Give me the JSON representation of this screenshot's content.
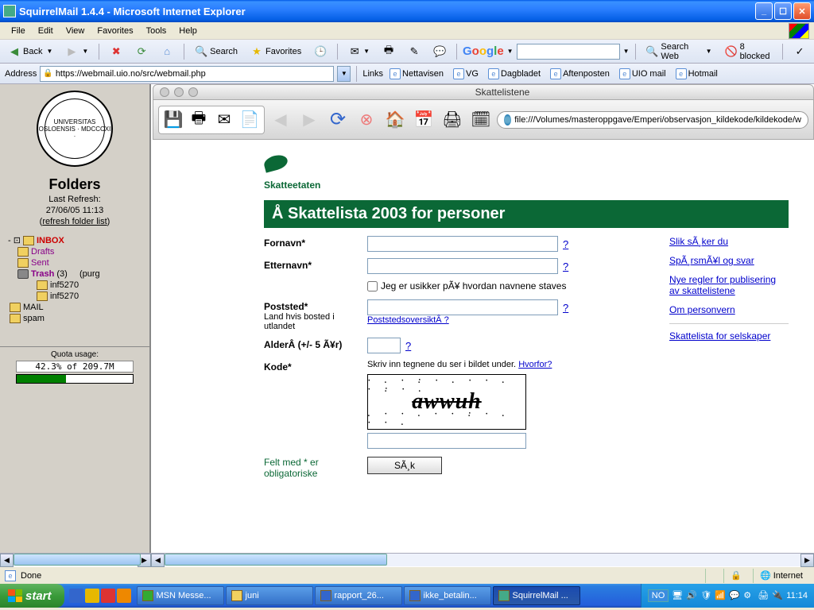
{
  "titlebar": {
    "title": "SquirrelMail 1.4.4 - Microsoft Internet Explorer"
  },
  "menu": {
    "file": "File",
    "edit": "Edit",
    "view": "View",
    "favorites": "Favorites",
    "tools": "Tools",
    "help": "Help"
  },
  "toolbar": {
    "back": "Back",
    "search": "Search",
    "favorites": "Favorites",
    "google_searchweb": "Search Web",
    "google_blocked": "8 blocked"
  },
  "addressbar": {
    "label": "Address",
    "url": "https://webmail.uio.no/src/webmail.php",
    "links_label": "Links",
    "links": [
      "Nettavisen",
      "VG",
      "Dagbladet",
      "Aftenposten",
      "UIO mail",
      "Hotmail"
    ]
  },
  "sidebar": {
    "logo_text": "UNIVERSITAS OSLOENSIS · MDCCCXI ·",
    "folders_title": "Folders",
    "last_refresh_label": "Last Refresh:",
    "last_refresh_time": "27/06/05 11:13",
    "refresh_link": "refresh folder list",
    "inbox": "INBOX",
    "drafts": "Drafts",
    "sent": "Sent",
    "trash": "Trash",
    "trash_count": "(3)",
    "trash_purge": "(purg",
    "inf5270": "inf5270",
    "mail": "MAIL",
    "spam": "spam",
    "quota_label": "Quota usage:",
    "quota_text": "42.3% of 209.7M"
  },
  "mac": {
    "title": "Skattelistene",
    "url": "file:///Volumes/masteroppgave/Emperi/observasjon_kildekode/kildekode/w"
  },
  "page": {
    "brand": "Skatteetaten",
    "banner": "Å Skattelista 2003 for personer",
    "labels": {
      "fornavn": "Fornavn*",
      "etternavn": "Etternavn*",
      "usikker": "Jeg er usikker pÃ¥ hvordan navnene staves",
      "poststed": "Poststed*",
      "poststed_sub": "Land hvis bosted i utlandet",
      "poststed_link": "PoststedsoversiktÂ ?",
      "alder": "AlderÂ (+/- 5 Ã¥r)",
      "kode": "Kode*",
      "kode_desc": "Skriv inn tegnene du ser i bildet under.",
      "hvorfor": "Hvorfor?",
      "captcha": "awwuh",
      "oblig": "Felt med * er obligatoriske",
      "submit": "SÃ¸k"
    },
    "sidelinks": [
      "Slik sÃ¸ker du",
      "SpÃ¸rsmÃ¥l og svar",
      "Nye regler for publisering av skattelistene",
      "Om personvern",
      "Skattelista for selskaper"
    ]
  },
  "statusbar": {
    "done": "Done",
    "internet": "Internet"
  },
  "taskbar": {
    "start": "start",
    "tasks": [
      "MSN Messe...",
      "juni",
      "rapport_26...",
      "ikke_betalin...",
      "SquirrelMail ..."
    ],
    "lang": "NO",
    "clock": "11:14"
  }
}
